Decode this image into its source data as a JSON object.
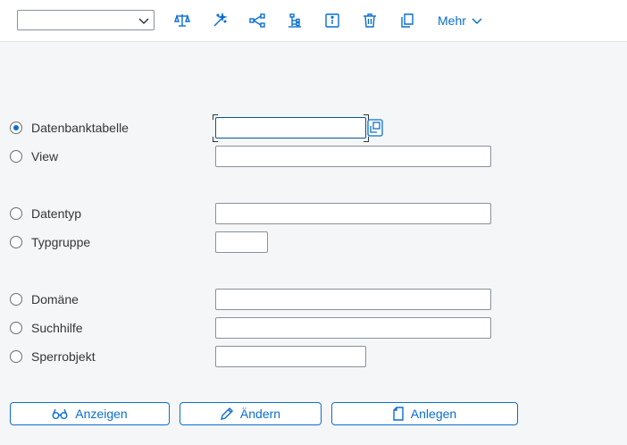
{
  "toolbar": {
    "command_field_value": "",
    "icons": [
      "compare-icon",
      "magic-wand-icon",
      "hierarchy-icon",
      "where-used-icon",
      "info-icon",
      "delete-icon",
      "copy-icon"
    ],
    "more_label": "Mehr"
  },
  "form": {
    "options": [
      {
        "label": "Datenbanktabelle",
        "selected": true
      },
      {
        "label": "View",
        "selected": false
      },
      {
        "label": "Datentyp",
        "selected": false
      },
      {
        "label": "Typgruppe",
        "selected": false
      },
      {
        "label": "Domäne",
        "selected": false
      },
      {
        "label": "Suchhilfe",
        "selected": false
      },
      {
        "label": "Sperrobjekt",
        "selected": false
      }
    ],
    "values": {
      "datenbanktabelle": "",
      "view": "",
      "datentyp": "",
      "typgruppe": "",
      "domaene": "",
      "suchhilfe": "",
      "sperrobjekt": ""
    }
  },
  "actions": {
    "display_label": "Anzeigen",
    "change_label": "Ändern",
    "create_label": "Anlegen"
  },
  "colors": {
    "accent": "#0a6ed1",
    "background": "#f5f6f7",
    "border": "#89919a"
  }
}
